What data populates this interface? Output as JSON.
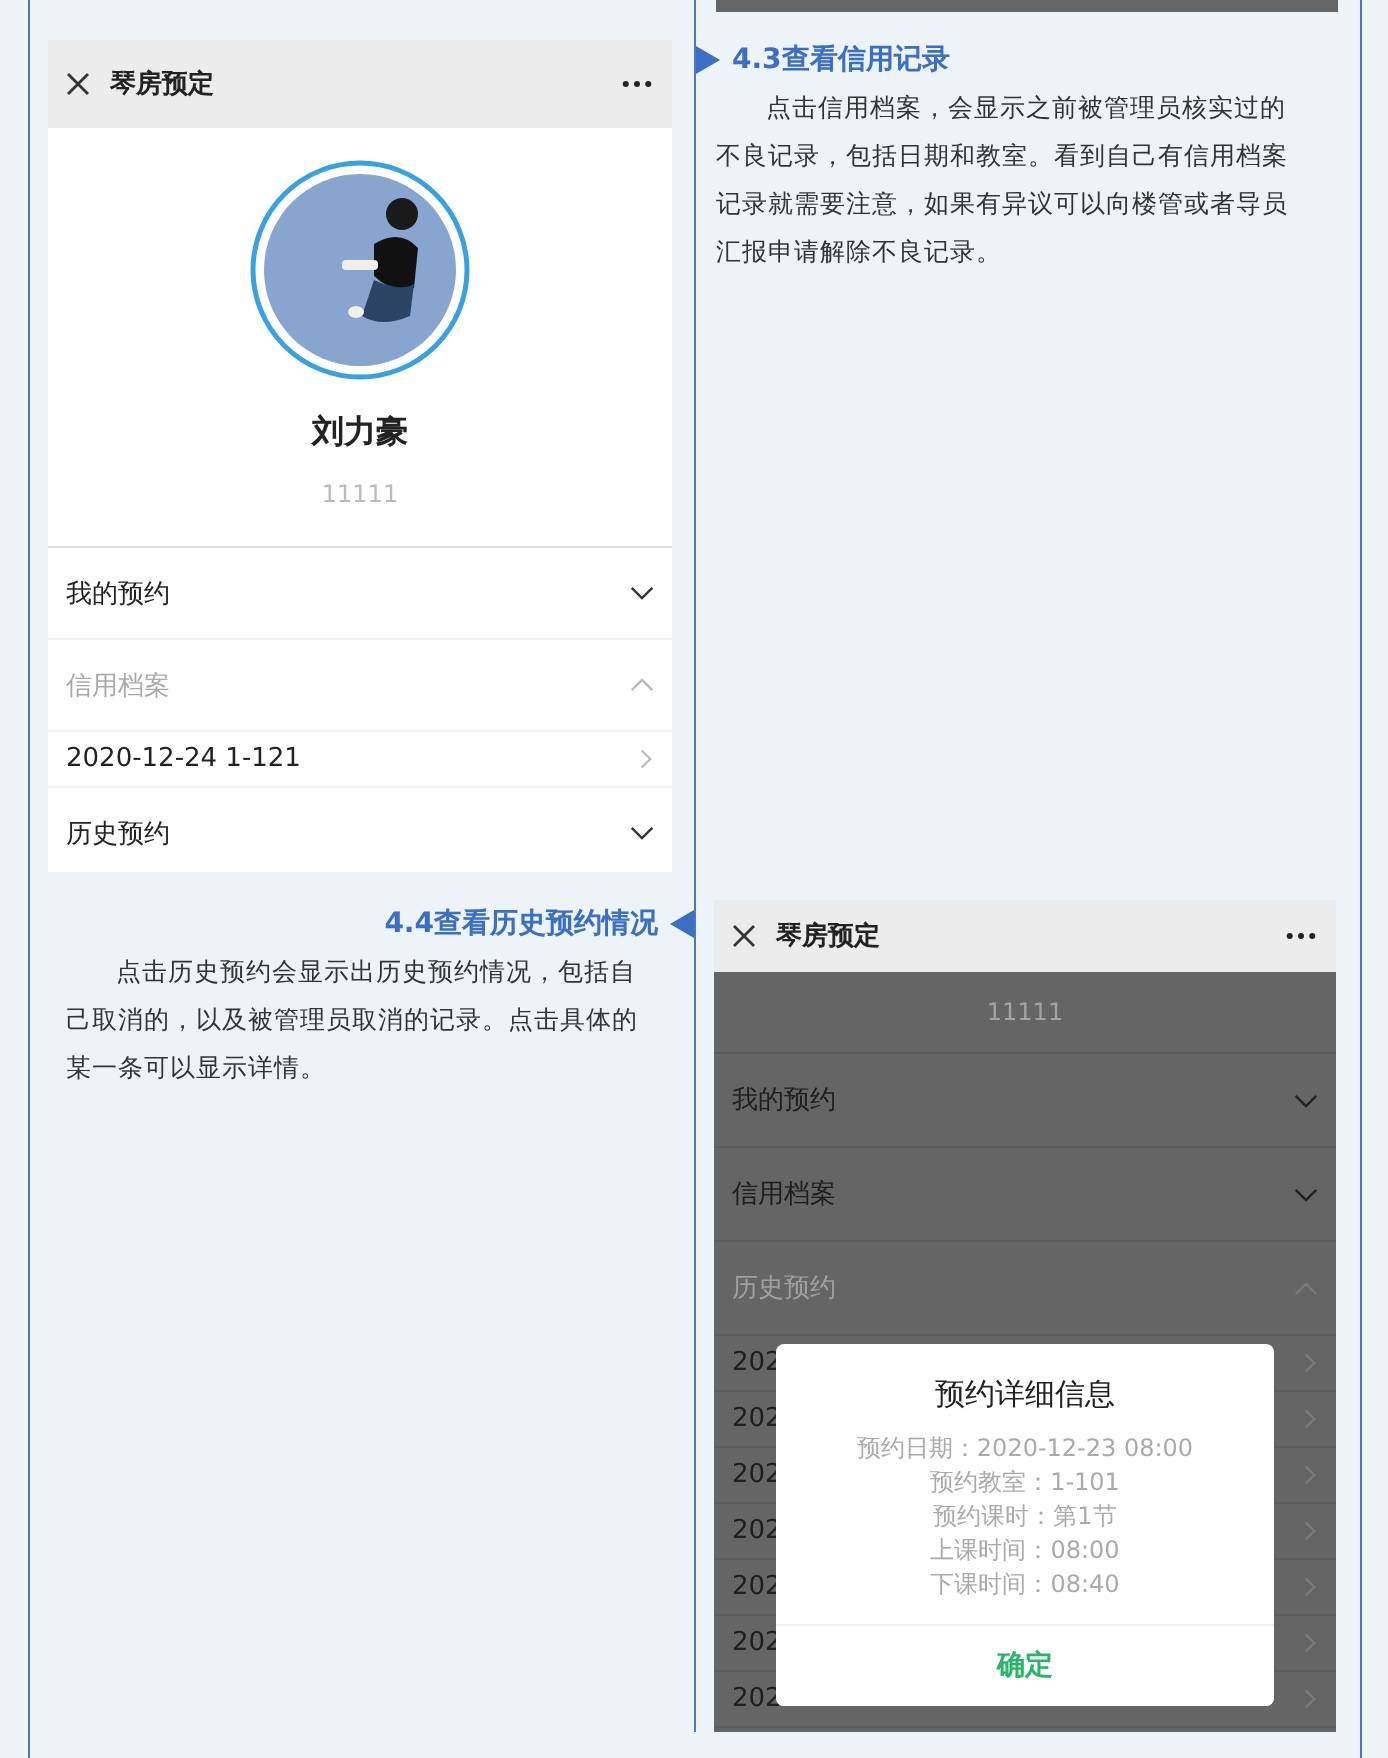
{
  "profile_screen": {
    "title": "琴房预定",
    "name": "刘力豪",
    "user_id": "11111",
    "sections": [
      {
        "label": "我的预约",
        "expanded": false
      },
      {
        "label": "信用档案",
        "expanded": true,
        "items": [
          "2020-12-24 1-121"
        ]
      },
      {
        "label": "历史预约",
        "expanded": false
      }
    ]
  },
  "section_4_3": {
    "heading": "4.3查看信用记录",
    "paragraph": "点击信用档案，会显示之前被管理员核实过的不良记录，包括日期和教室。看到自己有信用档案记录就需要注意，如果有异议可以向楼管或者导员汇报申请解除不良记录。"
  },
  "section_4_4": {
    "heading": "4.4查看历史预约情况",
    "paragraph": "点击历史预约会显示出历史预约情况，包括自己取消的，以及被管理员取消的记录。点击具体的某一条可以显示详情。"
  },
  "history_screen": {
    "title": "琴房预定",
    "user_id": "11111",
    "sections": [
      {
        "label": "我的预约",
        "expanded": false
      },
      {
        "label": "信用档案",
        "expanded": false
      },
      {
        "label": "历史预约",
        "expanded": true,
        "items": [
          "202",
          "202",
          "202",
          "202",
          "202",
          "202",
          "202"
        ]
      }
    ],
    "dialog": {
      "title": "预约详细信息",
      "lines": [
        "预约日期：2020-12-23 08:00",
        "预约教室：1-101",
        "预约课时：第1节",
        "上课时间：08:00",
        "下课时间：08:40"
      ],
      "button": "确定"
    }
  }
}
